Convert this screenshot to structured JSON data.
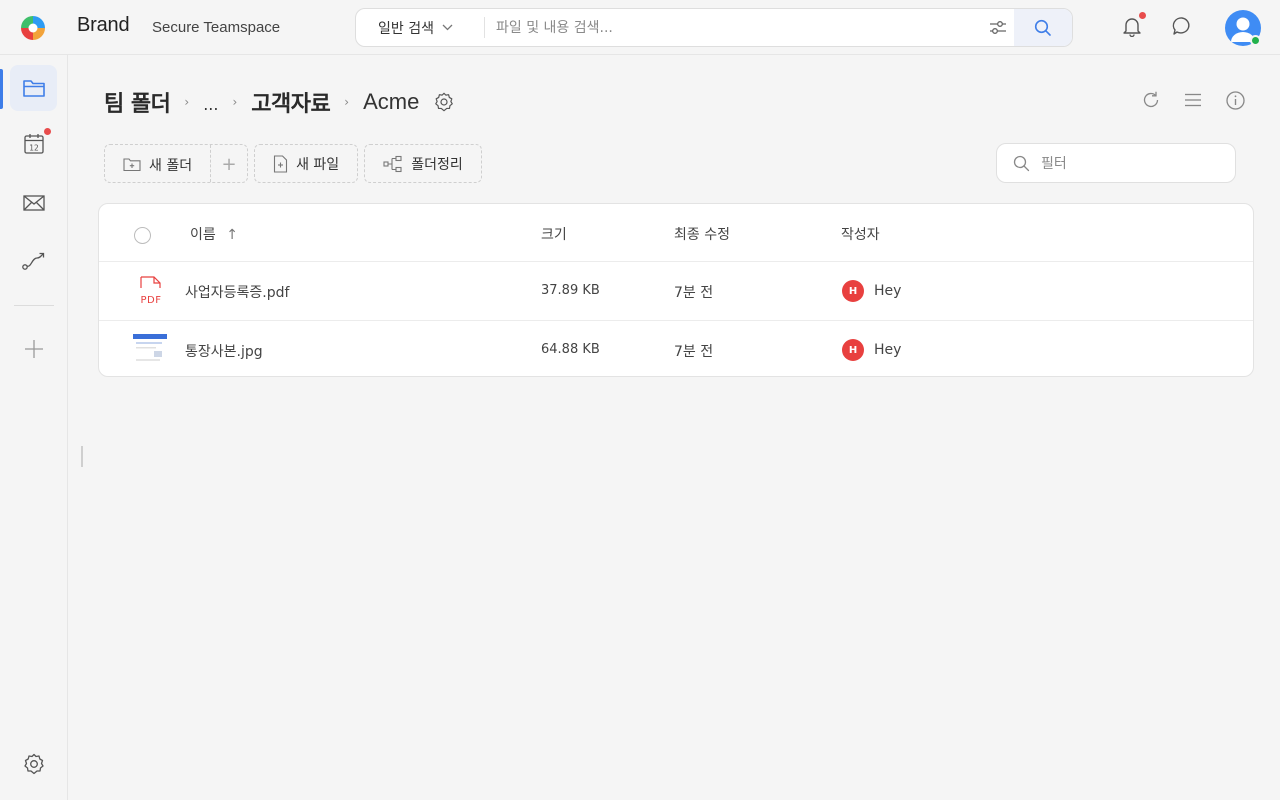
{
  "brand": {
    "name": "Brand",
    "subtitle": "Secure Teamspace"
  },
  "search": {
    "type_label": "일반 검색",
    "placeholder": "파일 및 내용 검색..."
  },
  "breadcrumb": {
    "root": "팀 폴더",
    "ellipsis": "...",
    "parent": "고객자료",
    "current": "Acme"
  },
  "toolbar": {
    "new_folder": "새 폴더",
    "plus": "+",
    "new_file": "새 파일",
    "organize": "폴더정리"
  },
  "filter": {
    "placeholder": "필터"
  },
  "table": {
    "headers": {
      "name": "이름",
      "size": "크기",
      "modified": "최종 수정",
      "author": "작성자"
    },
    "sort_indicator": "↑",
    "rows": [
      {
        "name": "사업자등록증.pdf",
        "size": "37.89 KB",
        "modified": "7분 전",
        "author_initial": "H",
        "author": "Hey",
        "type": "pdf",
        "type_label": "PDF"
      },
      {
        "name": "통장사본.jpg",
        "size": "64.88 KB",
        "modified": "7분 전",
        "author_initial": "H",
        "author": "Hey",
        "type": "image"
      }
    ]
  },
  "colors": {
    "accent": "#3f7ee8",
    "avatar_bg": "#3f8cf4",
    "author_badge": "#e8403f",
    "notification_dot": "#e84c4c",
    "online": "#22b14c"
  },
  "rail": {
    "items": [
      "folder-icon",
      "calendar-icon",
      "mail-icon",
      "workflow-icon",
      "add-icon"
    ],
    "calendar_day": "12",
    "bottom": "settings-icon"
  }
}
